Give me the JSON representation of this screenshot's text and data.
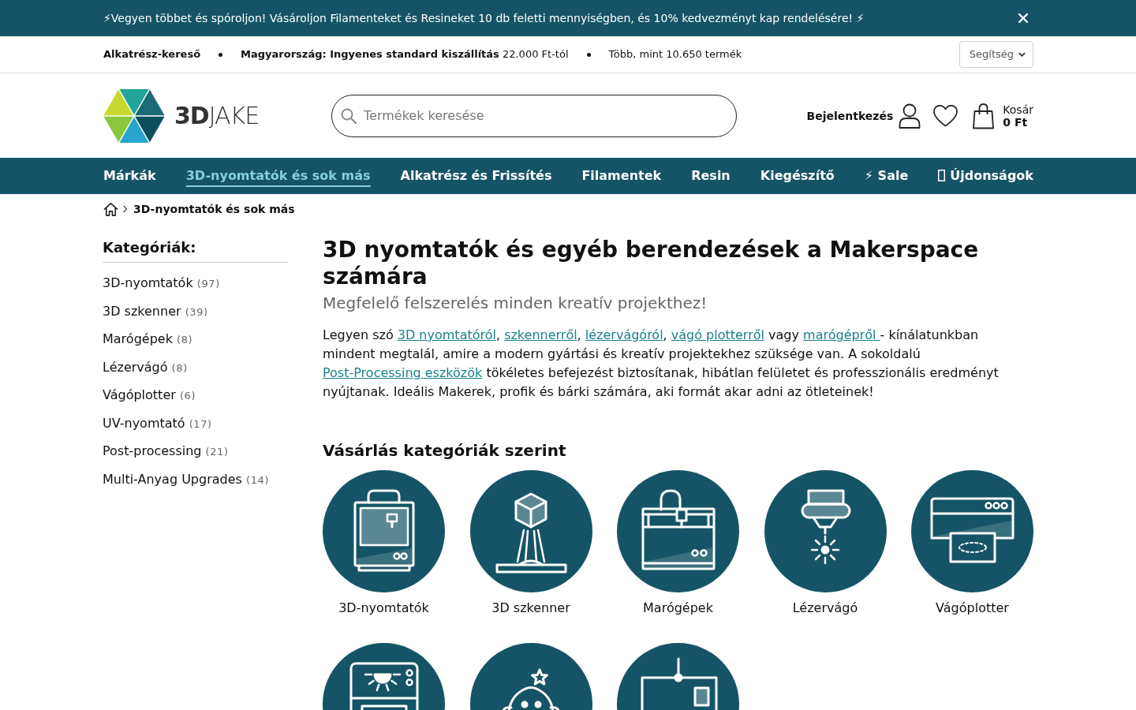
{
  "banner": {
    "text": "⚡Vegyen többet és spóroljon! Vásároljon Filamenteket és Resineket 10 db feletti mennyiségben, és 10% kedvezményt kap rendelésére! ⚡"
  },
  "info_bar": {
    "finder_link": "Alkatrész-kereső",
    "notes": [
      "**Magyarország: Ingyenes standard kiszállítás** 22.000 Ft-tól",
      "Több, mint 10.650 termék"
    ],
    "help": {
      "label": "Segítség"
    }
  },
  "header": {
    "logo": {
      "text": "**3D**JAKE"
    },
    "search": {
      "placeholder": "Termékek keresése"
    },
    "login": "Bejelentkezés",
    "cart": {
      "label": "Kosár",
      "total": "0 Ft"
    }
  },
  "nav": {
    "items": [
      {
        "kind": "text",
        "label": "Márkák",
        "selected": false
      },
      {
        "kind": "text",
        "label": "3D-nyomtatók és sok más",
        "selected": true
      },
      {
        "kind": "text",
        "label": "Alkatrész és Frissítés",
        "selected": false
      },
      {
        "kind": "text",
        "label": "Filamentek",
        "selected": false
      },
      {
        "kind": "text",
        "label": "Resin",
        "selected": false
      },
      {
        "kind": "text",
        "label": "Kiegészítő",
        "selected": false
      },
      {
        "kind": "text",
        "label": "⚡ Sale",
        "selected": false
      },
      {
        "kind": "glyph",
        "label": "Újdonságok",
        "selected": false
      }
    ]
  },
  "breadcrumb": {
    "current": "3D-nyomtatók és sok más"
  },
  "sidebar": {
    "title": "Kategóriák:",
    "items": [
      {
        "label": "3D-nyomtatók",
        "count": "(97)"
      },
      {
        "label": "3D szkenner",
        "count": "(39)"
      },
      {
        "label": "Marógépek",
        "count": "(8)"
      },
      {
        "label": "Lézervágó",
        "count": "(8)"
      },
      {
        "label": "Vágóplotter",
        "count": "(6)"
      },
      {
        "label": "UV-nyomtató",
        "count": "(17)"
      },
      {
        "label": "Post-processing",
        "count": "(21)"
      },
      {
        "label": "Multi-Anyag Upgrades",
        "count": "(14)"
      }
    ]
  },
  "content": {
    "title": "3D nyomtatók és egyéb berendezések a Makerspace számára",
    "subtitle": "Megfelelő felszerelés minden kreatív projekthez!",
    "intro": [
      {
        "kind": "text",
        "text": "Legyen szó "
      },
      {
        "kind": "link",
        "text": "3D nyomtatóról"
      },
      {
        "kind": "text",
        "text": ", "
      },
      {
        "kind": "link",
        "text": "szkennerről"
      },
      {
        "kind": "text",
        "text": ", "
      },
      {
        "kind": "link",
        "text": "lézervágóról"
      },
      {
        "kind": "text",
        "text": ", "
      },
      {
        "kind": "link",
        "text": "vágó plotterről"
      },
      {
        "kind": "text",
        "text": " vagy "
      },
      {
        "kind": "link",
        "text": "marógépről "
      },
      {
        "kind": "text",
        "text": "- kínálatunkban mindent megtalál, amire a modern gyártási és kreatív projektekhez szüksége van. A sokoldalú "
      },
      {
        "kind": "link",
        "text": "Post-Processing eszközök"
      },
      {
        "kind": "text",
        "text": " tökéletes befejezést biztosítanak, hibátlan felületet és professzionális eredményt nyújtanak. Ideális Makerek, profik és bárki számára, aki formát akar adni az ötleteinek!"
      }
    ],
    "section_title": "Vásárlás kategóriák szerint",
    "categories": [
      {
        "kind": "printer",
        "label": "3D-nyomtatók"
      },
      {
        "kind": "scanner",
        "label": "3D szkenner"
      },
      {
        "kind": "mill",
        "label": "Marógépek"
      },
      {
        "kind": "laser",
        "label": "Lézervágó"
      },
      {
        "kind": "plotter",
        "label": "Vágóplotter"
      },
      {
        "kind": "uv"
      },
      {
        "kind": "mascot"
      },
      {
        "kind": "gantry"
      }
    ]
  }
}
